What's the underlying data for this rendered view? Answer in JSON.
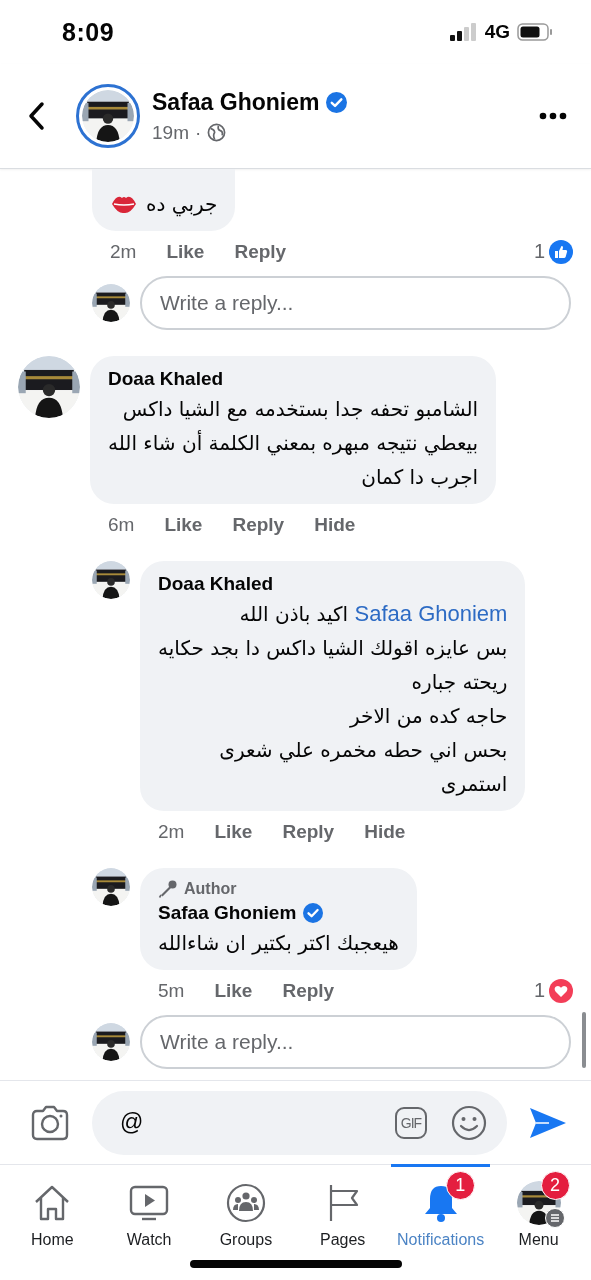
{
  "status_bar": {
    "time": "8:09",
    "network": "4G"
  },
  "header": {
    "name": "Safaa Ghoniem",
    "verified": true,
    "time": "19m",
    "separator": "·"
  },
  "comments": [
    {
      "children": [
        {
          "text": "جربي ده",
          "emoji": {
            "kind": "kiss"
          },
          "time": "2m",
          "actions": [
            "Like",
            "Reply"
          ],
          "reaction": {
            "kind": "like",
            "count": "1"
          }
        }
      ],
      "reply_box": {
        "placeholder": "Write a reply..."
      }
    },
    {
      "author": "Doaa Khaled",
      "text": "الشامبو تحفه جدا بستخدمه مع الشيا داكس\nبيعطي نتيجه مبهره بمعني الكلمة أن شاء الله\nاجرب دا كمان",
      "time": "6m",
      "actions": [
        "Like",
        "Reply",
        "Hide"
      ],
      "children": [
        {
          "author": "Doaa Khaled",
          "mention": "Safaa Ghoniem",
          "text": "اكيد باذن الله\nبس عايزه اقولك الشيا داكس دا بجد حكايه\nريحته جباره\nحاجه كده من الاخر\nبحس اني حطه مخمره علي شعرى\nاستمرى",
          "time": "2m",
          "actions": [
            "Like",
            "Reply",
            "Hide"
          ]
        },
        {
          "badge": "Author",
          "author": "Safaa Ghoniem",
          "verified": true,
          "text": "هيعجبك اكتر بكتير ان شاءالله",
          "time": "5m",
          "actions": [
            "Like",
            "Reply"
          ],
          "reaction": {
            "kind": "love",
            "count": "1"
          }
        }
      ],
      "reply_box": {
        "placeholder": "Write a reply..."
      }
    }
  ],
  "composer": {
    "value": "@",
    "gif_label": "GIF"
  },
  "tabs": [
    {
      "kind": "home",
      "label": "Home",
      "selected": false
    },
    {
      "kind": "watch",
      "label": "Watch",
      "selected": false
    },
    {
      "kind": "groups",
      "label": "Groups",
      "selected": false
    },
    {
      "kind": "pages",
      "label": "Pages",
      "selected": false
    },
    {
      "kind": "notifications",
      "label": "Notifications",
      "selected": true,
      "badge": "1"
    },
    {
      "kind": "menu",
      "label": "Menu",
      "selected": false,
      "badge": "2"
    }
  ]
}
